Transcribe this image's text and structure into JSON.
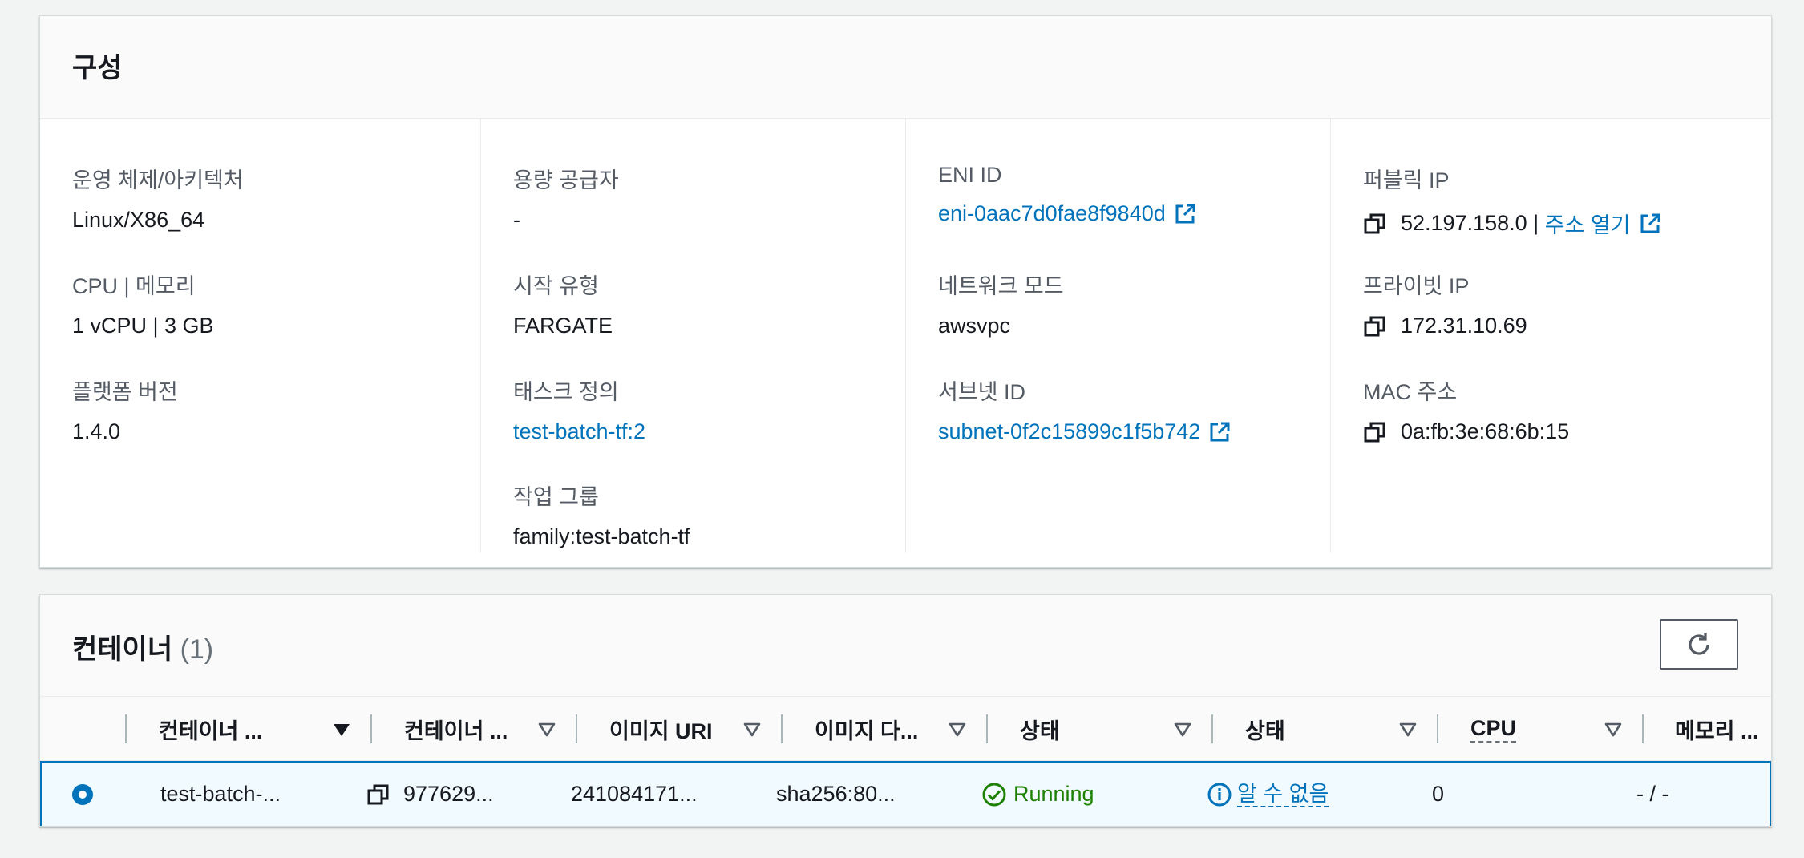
{
  "config": {
    "title": "구성",
    "columns": [
      [
        {
          "label": "운영 체제/아키텍처",
          "value": "Linux/X86_64"
        },
        {
          "label": "CPU | 메모리",
          "value": "1 vCPU | 3 GB"
        },
        {
          "label": "플랫폼 버전",
          "value": "1.4.0"
        }
      ],
      [
        {
          "label": "용량 공급자",
          "value": "-"
        },
        {
          "label": "시작 유형",
          "value": "FARGATE"
        },
        {
          "label": "태스크 정의",
          "value": "test-batch-tf:2"
        },
        {
          "label": "작업 그룹",
          "value": "family:test-batch-tf"
        }
      ],
      [
        {
          "label": "ENI ID",
          "value": "eni-0aac7d0fae8f9840d"
        },
        {
          "label": "네트워크 모드",
          "value": "awsvpc"
        },
        {
          "label": "서브넷 ID",
          "value": "subnet-0f2c15899c1f5b742"
        }
      ],
      [
        {
          "label": "퍼블릭 IP",
          "value": "52.197.158.0",
          "separator": " | ",
          "link": "주소 열기"
        },
        {
          "label": "프라이빗 IP",
          "value": "172.31.10.69"
        },
        {
          "label": "MAC 주소",
          "value": "0a:fb:3e:68:6b:15"
        }
      ]
    ]
  },
  "containers": {
    "title": "컨테이너",
    "count": "(1)",
    "headers": [
      "컨테이너 ...",
      "컨테이너 ...",
      "이미지 URI",
      "이미지 다...",
      "상태",
      "상태",
      "CPU",
      "메모리 ..."
    ],
    "row": {
      "name": "test-batch-...",
      "id": "977629...",
      "image_uri": "241084171...",
      "image_digest": "sha256:80...",
      "status": "Running",
      "health": "알 수 없음",
      "cpu": "0",
      "memory": "- / -"
    }
  },
  "colors": {
    "link": "#0073bb",
    "success": "#1d8102",
    "selected_row_bg": "#f1faff"
  },
  "icons": [
    "external-link-icon",
    "copy-icon",
    "refresh-icon",
    "sort-desc-icon",
    "sort-icon",
    "status-success-icon",
    "info-icon",
    "radio-selected-icon"
  ]
}
